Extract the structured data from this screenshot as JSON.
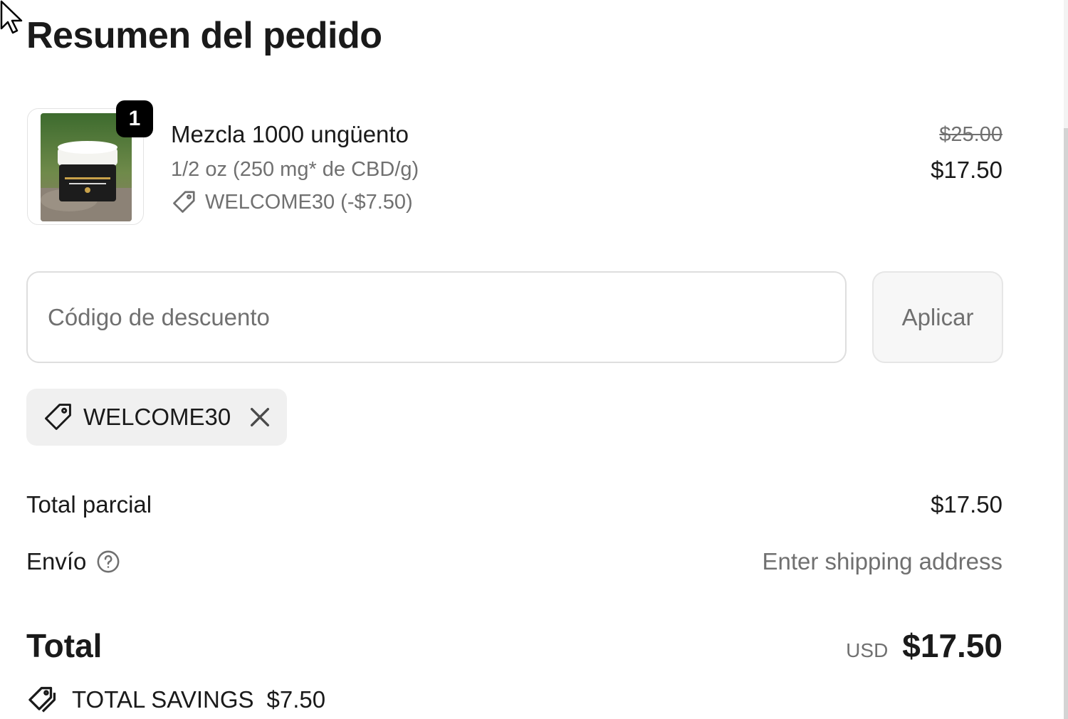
{
  "summary": {
    "title": "Resumen del pedido"
  },
  "line_item": {
    "quantity": "1",
    "name": "Mezcla 1000 ungüento",
    "variant": "1/2 oz (250 mg* de CBD/g)",
    "discount_text": "WELCOME30 (-$7.50)",
    "original_price": "$25.00",
    "final_price": "$17.50"
  },
  "discount": {
    "placeholder": "Código de descuento",
    "apply_label": "Aplicar",
    "applied_code": "WELCOME30"
  },
  "totals": {
    "subtotal_label": "Total parcial",
    "subtotal_value": "$17.50",
    "shipping_label": "Envío",
    "shipping_value": "Enter shipping address",
    "total_label": "Total",
    "currency": "USD",
    "total_value": "$17.50",
    "savings_label": "TOTAL SAVINGS",
    "savings_value": "$7.50"
  },
  "colors": {
    "text": "#1a1a1a",
    "muted": "#707070",
    "badge": "#000000",
    "chip_bg": "#f0f0f0"
  }
}
